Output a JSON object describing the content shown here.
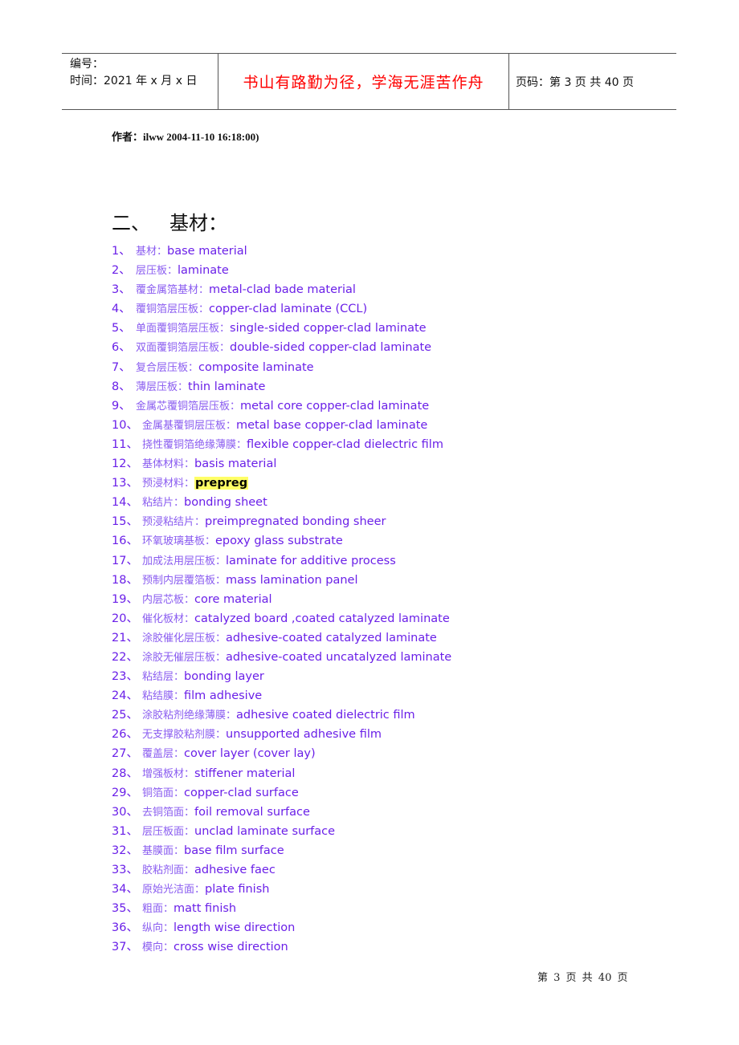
{
  "header": {
    "number_label": "编号：",
    "time_label": "时间：2021 年 x 月 x 日",
    "motto": "书山有路勤为径，学海无涯苦作舟",
    "page_label": "页码：第 3 页  共 40 页"
  },
  "author_line": "作者：ilww 2004-11-10 16:18:00)",
  "section_title": {
    "number": "二、",
    "title": "基材："
  },
  "colors": {
    "term_text": "#6a1fe8",
    "motto": "#ff0000",
    "highlight": "#ffff66"
  },
  "terms": [
    {
      "num": "1、",
      "zh": "基材：",
      "en": "base material"
    },
    {
      "num": "2、",
      "zh": "层压板：",
      "en": "laminate"
    },
    {
      "num": "3、",
      "zh": "覆金属箔基材：",
      "en": "metal-clad bade material"
    },
    {
      "num": "4、",
      "zh": "覆铜箔层压板：",
      "en": "copper-clad laminate (CCL)"
    },
    {
      "num": "5、",
      "zh": "单面覆铜箔层压板：",
      "en": "single-sided copper-clad laminate"
    },
    {
      "num": "6、",
      "zh": "双面覆铜箔层压板：",
      "en": "double-sided copper-clad laminate"
    },
    {
      "num": "7、",
      "zh": "复合层压板：",
      "en": "composite laminate"
    },
    {
      "num": "8、",
      "zh": "薄层压板：",
      "en": "thin laminate"
    },
    {
      "num": "9、",
      "zh": "金属芯覆铜箔层压板：",
      "en": "metal core copper-clad laminate"
    },
    {
      "num": "10、",
      "zh": "金属基覆铜层压板：",
      "en": "metal base copper-clad laminate"
    },
    {
      "num": "11、",
      "zh": "挠性覆铜箔绝缘薄膜：",
      "en": "flexible copper-clad dielectric film"
    },
    {
      "num": "12、",
      "zh": "基体材料：",
      "en": "basis material"
    },
    {
      "num": "13、",
      "zh": "预浸材料：",
      "en": "prepreg",
      "highlight": true
    },
    {
      "num": "14、",
      "zh": "粘结片：",
      "en": "bonding sheet"
    },
    {
      "num": "15、",
      "zh": "预浸粘结片：",
      "en": "preimpregnated bonding sheer"
    },
    {
      "num": "16、",
      "zh": "环氧玻璃基板：",
      "en": "epoxy glass substrate"
    },
    {
      "num": "17、",
      "zh": "加成法用层压板：",
      "en": "laminate for additive process"
    },
    {
      "num": "18、",
      "zh": "预制内层覆箔板：",
      "en": "mass lamination panel"
    },
    {
      "num": "19、",
      "zh": "内层芯板：",
      "en": "core material"
    },
    {
      "num": "20、",
      "zh": "催化板材：",
      "en": "catalyzed board ,coated catalyzed laminate"
    },
    {
      "num": "21、",
      "zh": "涂胶催化层压板：",
      "en": "adhesive-coated catalyzed laminate"
    },
    {
      "num": "22、",
      "zh": "涂胶无催层压板：",
      "en": "adhesive-coated uncatalyzed laminate"
    },
    {
      "num": "23、",
      "zh": "粘结层：",
      "en": "bonding layer"
    },
    {
      "num": "24、",
      "zh": "粘结膜：",
      "en": "film adhesive"
    },
    {
      "num": "25、",
      "zh": "涂胶粘剂绝缘薄膜：",
      "en": "adhesive coated dielectric film"
    },
    {
      "num": "26、",
      "zh": "无支撑胶粘剂膜：",
      "en": "unsupported adhesive film"
    },
    {
      "num": "27、",
      "zh": "覆盖层：",
      "en": "cover layer (cover lay)"
    },
    {
      "num": "28、",
      "zh": "增强板材：",
      "en": "stiffener material"
    },
    {
      "num": "29、",
      "zh": "铜箔面：",
      "en": "copper-clad surface"
    },
    {
      "num": "30、",
      "zh": "去铜箔面：",
      "en": "foil removal surface"
    },
    {
      "num": "31、",
      "zh": "层压板面：",
      "en": "unclad laminate surface"
    },
    {
      "num": "32、",
      "zh": "基膜面：",
      "en": "base film surface"
    },
    {
      "num": "33、",
      "zh": "胶粘剂面：",
      "en": "adhesive faec"
    },
    {
      "num": "34、",
      "zh": "原始光洁面：",
      "en": "plate finish"
    },
    {
      "num": "35、",
      "zh": "粗面：",
      "en": "matt finish"
    },
    {
      "num": "36、",
      "zh": "纵向：",
      "en": "length wise direction"
    },
    {
      "num": "37、",
      "zh": "模向：",
      "en": "cross wise direction"
    }
  ],
  "footer": {
    "page_text": "第 3 页 共 40 页"
  }
}
